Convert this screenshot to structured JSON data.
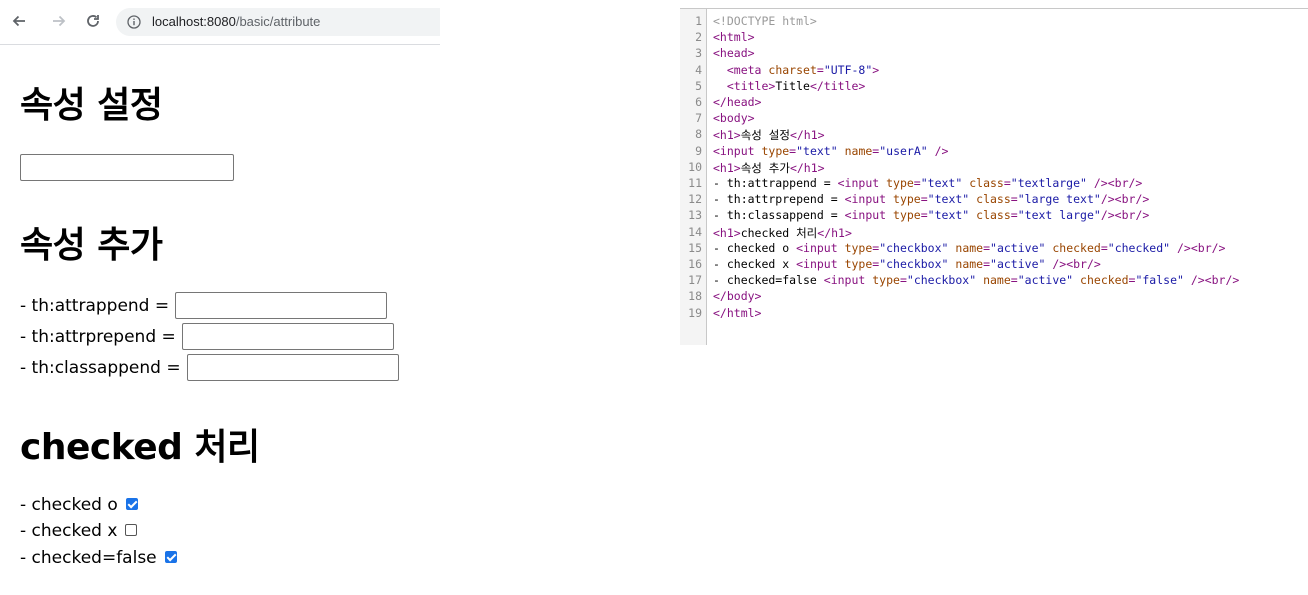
{
  "browser": {
    "url_host": "localhost:8080",
    "url_path": "/basic/attribute"
  },
  "page": {
    "heading1": "속성 설정",
    "heading2": "속성 추가",
    "heading3": "checked 처리",
    "attr_rows": [
      {
        "label": "- th:attrappend =",
        "value": ""
      },
      {
        "label": "- th:attrprepend =",
        "value": ""
      },
      {
        "label": "- th:classappend =",
        "value": ""
      }
    ],
    "checks": [
      {
        "label": "- checked o",
        "checked": true
      },
      {
        "label": "- checked x",
        "checked": false
      },
      {
        "label": "- checked=false",
        "checked": true
      }
    ]
  },
  "source": {
    "lines": [
      {
        "n": "1",
        "segments": [
          [
            "doctype",
            "<!DOCTYPE html>"
          ]
        ]
      },
      {
        "n": "2",
        "segments": [
          [
            "tag",
            "<html>"
          ]
        ]
      },
      {
        "n": "3",
        "segments": [
          [
            "tag",
            "<head>"
          ]
        ]
      },
      {
        "n": "4",
        "segments": [
          [
            "txt",
            "  "
          ],
          [
            "tag",
            "<meta "
          ],
          [
            "attr",
            "charset"
          ],
          [
            "tag",
            "="
          ],
          [
            "val",
            "\"UTF-8\""
          ],
          [
            "tag",
            ">"
          ]
        ]
      },
      {
        "n": "5",
        "segments": [
          [
            "txt",
            "  "
          ],
          [
            "tag",
            "<title>"
          ],
          [
            "txt",
            "Title"
          ],
          [
            "tag",
            "</title>"
          ]
        ]
      },
      {
        "n": "6",
        "segments": [
          [
            "tag",
            "</head>"
          ]
        ]
      },
      {
        "n": "7",
        "segments": [
          [
            "tag",
            "<body>"
          ]
        ]
      },
      {
        "n": "8",
        "segments": [
          [
            "tag",
            "<h1>"
          ],
          [
            "txt",
            "속성 설정"
          ],
          [
            "tag",
            "</h1>"
          ]
        ]
      },
      {
        "n": "9",
        "segments": [
          [
            "tag",
            "<input "
          ],
          [
            "attr",
            "type"
          ],
          [
            "tag",
            "="
          ],
          [
            "val",
            "\"text\""
          ],
          [
            "tag",
            " "
          ],
          [
            "attr",
            "name"
          ],
          [
            "tag",
            "="
          ],
          [
            "val",
            "\"userA\""
          ],
          [
            "tag",
            " />"
          ]
        ]
      },
      {
        "n": "10",
        "segments": [
          [
            "tag",
            "<h1>"
          ],
          [
            "txt",
            "속성 추가"
          ],
          [
            "tag",
            "</h1>"
          ]
        ]
      },
      {
        "n": "11",
        "segments": [
          [
            "txt",
            "- th:attrappend = "
          ],
          [
            "tag",
            "<input "
          ],
          [
            "attr",
            "type"
          ],
          [
            "tag",
            "="
          ],
          [
            "val",
            "\"text\""
          ],
          [
            "tag",
            " "
          ],
          [
            "attr",
            "class"
          ],
          [
            "tag",
            "="
          ],
          [
            "val",
            "\"textlarge\""
          ],
          [
            "tag",
            " />"
          ],
          [
            "tag",
            "<br/>"
          ]
        ]
      },
      {
        "n": "12",
        "segments": [
          [
            "txt",
            "- th:attrprepend = "
          ],
          [
            "tag",
            "<input "
          ],
          [
            "attr",
            "type"
          ],
          [
            "tag",
            "="
          ],
          [
            "val",
            "\"text\""
          ],
          [
            "tag",
            " "
          ],
          [
            "attr",
            "class"
          ],
          [
            "tag",
            "="
          ],
          [
            "val",
            "\"large text\""
          ],
          [
            "tag",
            "/>"
          ],
          [
            "tag",
            "<br/>"
          ]
        ]
      },
      {
        "n": "13",
        "segments": [
          [
            "txt",
            "- th:classappend = "
          ],
          [
            "tag",
            "<input "
          ],
          [
            "attr",
            "type"
          ],
          [
            "tag",
            "="
          ],
          [
            "val",
            "\"text\""
          ],
          [
            "tag",
            " "
          ],
          [
            "attr",
            "class"
          ],
          [
            "tag",
            "="
          ],
          [
            "val",
            "\"text large\""
          ],
          [
            "tag",
            "/>"
          ],
          [
            "tag",
            "<br/>"
          ]
        ]
      },
      {
        "n": "14",
        "segments": [
          [
            "tag",
            "<h1>"
          ],
          [
            "txt",
            "checked 처리"
          ],
          [
            "tag",
            "</h1>"
          ]
        ]
      },
      {
        "n": "15",
        "segments": [
          [
            "txt",
            "- checked o "
          ],
          [
            "tag",
            "<input "
          ],
          [
            "attr",
            "type"
          ],
          [
            "tag",
            "="
          ],
          [
            "val",
            "\"checkbox\""
          ],
          [
            "tag",
            " "
          ],
          [
            "attr",
            "name"
          ],
          [
            "tag",
            "="
          ],
          [
            "val",
            "\"active\""
          ],
          [
            "tag",
            " "
          ],
          [
            "attr",
            "checked"
          ],
          [
            "tag",
            "="
          ],
          [
            "val",
            "\"checked\""
          ],
          [
            "tag",
            " />"
          ],
          [
            "tag",
            "<br/>"
          ]
        ]
      },
      {
        "n": "16",
        "segments": [
          [
            "txt",
            "- checked x "
          ],
          [
            "tag",
            "<input "
          ],
          [
            "attr",
            "type"
          ],
          [
            "tag",
            "="
          ],
          [
            "val",
            "\"checkbox\""
          ],
          [
            "tag",
            " "
          ],
          [
            "attr",
            "name"
          ],
          [
            "tag",
            "="
          ],
          [
            "val",
            "\"active\""
          ],
          [
            "tag",
            " />"
          ],
          [
            "tag",
            "<br/>"
          ]
        ]
      },
      {
        "n": "17",
        "segments": [
          [
            "txt",
            "- checked=false "
          ],
          [
            "tag",
            "<input "
          ],
          [
            "attr",
            "type"
          ],
          [
            "tag",
            "="
          ],
          [
            "val",
            "\"checkbox\""
          ],
          [
            "tag",
            " "
          ],
          [
            "attr",
            "name"
          ],
          [
            "tag",
            "="
          ],
          [
            "val",
            "\"active\""
          ],
          [
            "tag",
            " "
          ],
          [
            "attr",
            "checked"
          ],
          [
            "tag",
            "="
          ],
          [
            "val",
            "\"false\""
          ],
          [
            "tag",
            " />"
          ],
          [
            "tag",
            "<br/>"
          ]
        ]
      },
      {
        "n": "18",
        "segments": [
          [
            "tag",
            "</body>"
          ]
        ]
      },
      {
        "n": "19",
        "segments": [
          [
            "tag",
            "</html>"
          ]
        ]
      }
    ]
  }
}
